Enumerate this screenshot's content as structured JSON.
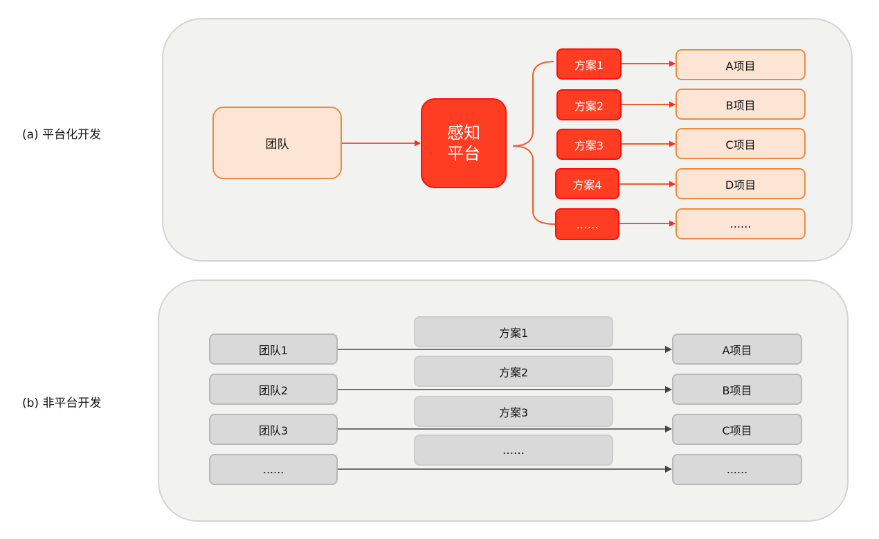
{
  "colors": {
    "panel_bg": "#f2f2f1",
    "accent_red": "#ff3d22",
    "orange_fill": "#fce5d4",
    "orange_border": "#ef8a3c",
    "gray_fill": "#d9d9d9",
    "arrow_dark": "#444444"
  },
  "section_a": {
    "label": "(a) 平台化开发",
    "team": "团队",
    "platform": [
      "感知",
      "平台"
    ],
    "schemes": [
      "方案1",
      "方案2",
      "方案3",
      "方案4",
      "……"
    ],
    "projects": [
      "A项目",
      "B项目",
      "C项目",
      "D项目",
      "......"
    ]
  },
  "section_b": {
    "label": "(b) 非平台开发",
    "teams": [
      "团队1",
      "团队2",
      "团队3",
      "......"
    ],
    "schemes": [
      "方案1",
      "方案2",
      "方案3",
      "……"
    ],
    "projects": [
      "A项目",
      "B项目",
      "C项目",
      "......"
    ]
  }
}
